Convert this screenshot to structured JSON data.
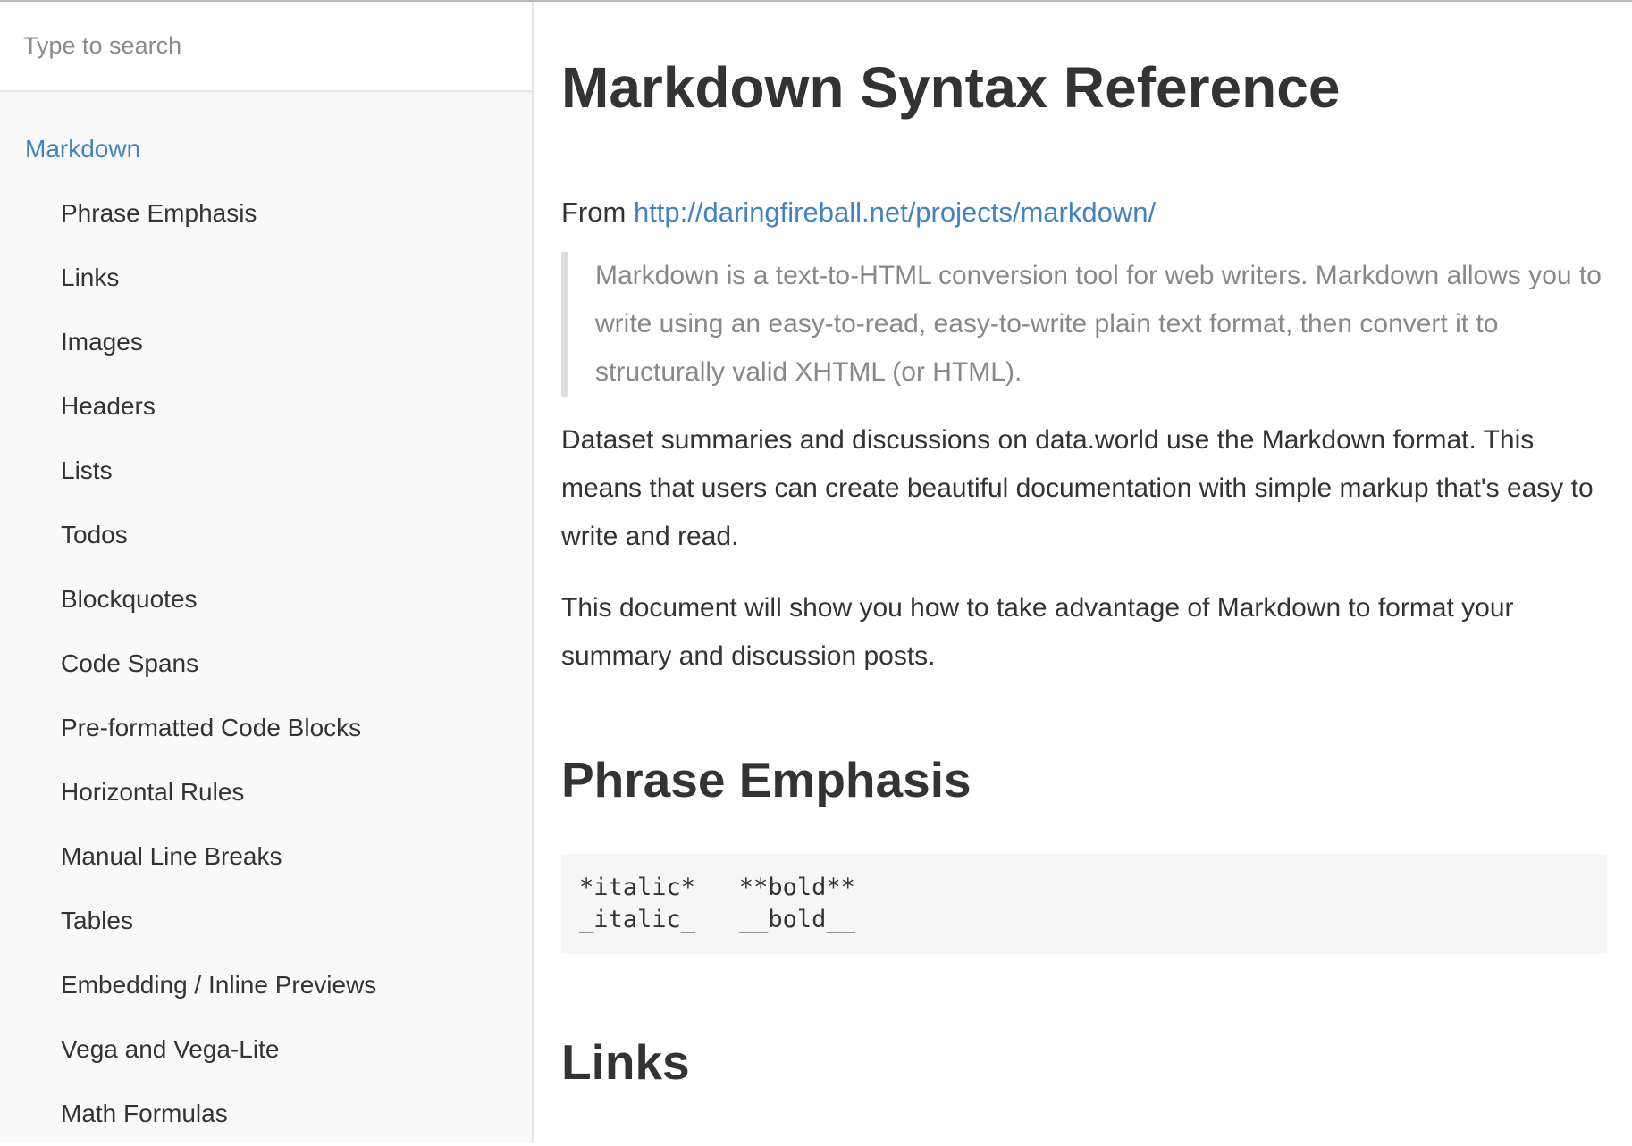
{
  "search": {
    "placeholder": "Type to search"
  },
  "sidebar": {
    "top_item": "Markdown",
    "items": [
      "Phrase Emphasis",
      "Links",
      "Images",
      "Headers",
      "Lists",
      "Todos",
      "Blockquotes",
      "Code Spans",
      "Pre-formatted Code Blocks",
      "Horizontal Rules",
      "Manual Line Breaks",
      "Tables",
      "Embedding / Inline Previews",
      "Vega and Vega-Lite",
      "Math Formulas"
    ]
  },
  "main": {
    "title": "Markdown Syntax Reference",
    "from_label": "From",
    "from_link": "http://daringfireball.net/projects/markdown/",
    "quote": "Markdown is a text-to-HTML conversion tool for web writers. Markdown allows you to write using an easy-to-read, easy-to-write plain text format, then convert it to structurally valid XHTML (or HTML).",
    "paragraph1": "Dataset summaries and discussions on data.world use the Markdown format. This means that users can create beautiful documentation with simple markup that's easy to write and read.",
    "paragraph2": "This document will show you how to take advantage of Markdown to format your summary and discussion posts.",
    "section1_title": "Phrase Emphasis",
    "section1_code": "*italic*   **bold**\n_italic_   __bold__",
    "section2_title": "Links"
  },
  "colors": {
    "link": "#4183c4",
    "sidebar_bg": "#f9f9f9",
    "quote_text": "#888888",
    "code_bg": "#f6f6f6"
  }
}
